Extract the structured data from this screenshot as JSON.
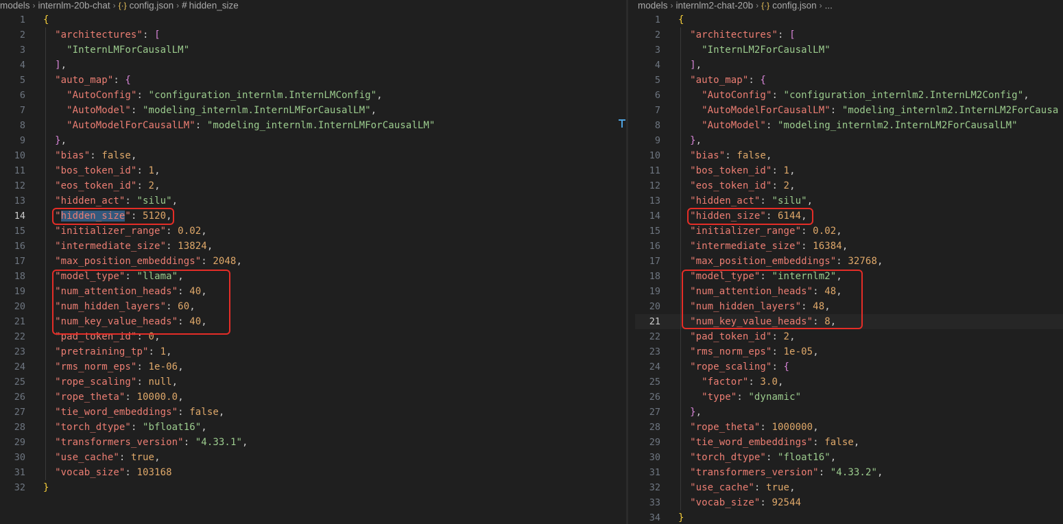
{
  "left": {
    "breadcrumb": [
      "models",
      "internlm-20b-chat",
      "config.json",
      "hidden_size"
    ],
    "active_line": 14,
    "lines": [
      [
        {
          "t": "{",
          "c": "br"
        }
      ],
      [
        {
          "t": "  "
        },
        {
          "t": "\"architectures\"",
          "c": "k"
        },
        {
          "t": ": "
        },
        {
          "t": "[",
          "c": "br2"
        }
      ],
      [
        {
          "t": "    "
        },
        {
          "t": "\"InternLMForCausalLM\"",
          "c": "s"
        }
      ],
      [
        {
          "t": "  "
        },
        {
          "t": "]",
          "c": "br2"
        },
        {
          "t": ","
        }
      ],
      [
        {
          "t": "  "
        },
        {
          "t": "\"auto_map\"",
          "c": "k"
        },
        {
          "t": ": "
        },
        {
          "t": "{",
          "c": "br2"
        }
      ],
      [
        {
          "t": "    "
        },
        {
          "t": "\"AutoConfig\"",
          "c": "k"
        },
        {
          "t": ": "
        },
        {
          "t": "\"configuration_internlm.InternLMConfig\"",
          "c": "s"
        },
        {
          "t": ","
        }
      ],
      [
        {
          "t": "    "
        },
        {
          "t": "\"AutoModel\"",
          "c": "k"
        },
        {
          "t": ": "
        },
        {
          "t": "\"modeling_internlm.InternLMForCausalLM\"",
          "c": "s"
        },
        {
          "t": ","
        }
      ],
      [
        {
          "t": "    "
        },
        {
          "t": "\"AutoModelForCausalLM\"",
          "c": "k"
        },
        {
          "t": ": "
        },
        {
          "t": "\"modeling_internlm.InternLMForCausalLM\"",
          "c": "s"
        }
      ],
      [
        {
          "t": "  "
        },
        {
          "t": "}",
          "c": "br2"
        },
        {
          "t": ","
        }
      ],
      [
        {
          "t": "  "
        },
        {
          "t": "\"bias\"",
          "c": "k"
        },
        {
          "t": ": "
        },
        {
          "t": "false",
          "c": "c"
        },
        {
          "t": ","
        }
      ],
      [
        {
          "t": "  "
        },
        {
          "t": "\"bos_token_id\"",
          "c": "k"
        },
        {
          "t": ": "
        },
        {
          "t": "1",
          "c": "n"
        },
        {
          "t": ","
        }
      ],
      [
        {
          "t": "  "
        },
        {
          "t": "\"eos_token_id\"",
          "c": "k"
        },
        {
          "t": ": "
        },
        {
          "t": "2",
          "c": "n"
        },
        {
          "t": ","
        }
      ],
      [
        {
          "t": "  "
        },
        {
          "t": "\"hidden_act\"",
          "c": "k"
        },
        {
          "t": ": "
        },
        {
          "t": "\"silu\"",
          "c": "s"
        },
        {
          "t": ","
        }
      ],
      [
        {
          "t": "  "
        },
        {
          "t": "\"",
          "c": "k"
        },
        {
          "t": "hidden_size",
          "c": "k sel"
        },
        {
          "t": "\"",
          "c": "k"
        },
        {
          "t": ": "
        },
        {
          "t": "5120",
          "c": "n"
        },
        {
          "t": ","
        }
      ],
      [
        {
          "t": "  "
        },
        {
          "t": "\"initializer_range\"",
          "c": "k"
        },
        {
          "t": ": "
        },
        {
          "t": "0.02",
          "c": "n"
        },
        {
          "t": ","
        }
      ],
      [
        {
          "t": "  "
        },
        {
          "t": "\"intermediate_size\"",
          "c": "k"
        },
        {
          "t": ": "
        },
        {
          "t": "13824",
          "c": "n"
        },
        {
          "t": ","
        }
      ],
      [
        {
          "t": "  "
        },
        {
          "t": "\"max_position_embeddings\"",
          "c": "k"
        },
        {
          "t": ": "
        },
        {
          "t": "2048",
          "c": "n"
        },
        {
          "t": ","
        }
      ],
      [
        {
          "t": "  "
        },
        {
          "t": "\"model_type\"",
          "c": "k"
        },
        {
          "t": ": "
        },
        {
          "t": "\"llama\"",
          "c": "s"
        },
        {
          "t": ","
        }
      ],
      [
        {
          "t": "  "
        },
        {
          "t": "\"num_attention_heads\"",
          "c": "k"
        },
        {
          "t": ": "
        },
        {
          "t": "40",
          "c": "n"
        },
        {
          "t": ","
        }
      ],
      [
        {
          "t": "  "
        },
        {
          "t": "\"num_hidden_layers\"",
          "c": "k"
        },
        {
          "t": ": "
        },
        {
          "t": "60",
          "c": "n"
        },
        {
          "t": ","
        }
      ],
      [
        {
          "t": "  "
        },
        {
          "t": "\"num_key_value_heads\"",
          "c": "k"
        },
        {
          "t": ": "
        },
        {
          "t": "40",
          "c": "n"
        },
        {
          "t": ","
        }
      ],
      [
        {
          "t": "  "
        },
        {
          "t": "\"pad_token_id\"",
          "c": "k"
        },
        {
          "t": ": "
        },
        {
          "t": "0",
          "c": "n"
        },
        {
          "t": ","
        }
      ],
      [
        {
          "t": "  "
        },
        {
          "t": "\"pretraining_tp\"",
          "c": "k"
        },
        {
          "t": ": "
        },
        {
          "t": "1",
          "c": "n"
        },
        {
          "t": ","
        }
      ],
      [
        {
          "t": "  "
        },
        {
          "t": "\"rms_norm_eps\"",
          "c": "k"
        },
        {
          "t": ": "
        },
        {
          "t": "1e-06",
          "c": "n"
        },
        {
          "t": ","
        }
      ],
      [
        {
          "t": "  "
        },
        {
          "t": "\"rope_scaling\"",
          "c": "k"
        },
        {
          "t": ": "
        },
        {
          "t": "null",
          "c": "c"
        },
        {
          "t": ","
        }
      ],
      [
        {
          "t": "  "
        },
        {
          "t": "\"rope_theta\"",
          "c": "k"
        },
        {
          "t": ": "
        },
        {
          "t": "10000.0",
          "c": "n"
        },
        {
          "t": ","
        }
      ],
      [
        {
          "t": "  "
        },
        {
          "t": "\"tie_word_embeddings\"",
          "c": "k"
        },
        {
          "t": ": "
        },
        {
          "t": "false",
          "c": "c"
        },
        {
          "t": ","
        }
      ],
      [
        {
          "t": "  "
        },
        {
          "t": "\"torch_dtype\"",
          "c": "k"
        },
        {
          "t": ": "
        },
        {
          "t": "\"bfloat16\"",
          "c": "s"
        },
        {
          "t": ","
        }
      ],
      [
        {
          "t": "  "
        },
        {
          "t": "\"transformers_version\"",
          "c": "k"
        },
        {
          "t": ": "
        },
        {
          "t": "\"4.33.1\"",
          "c": "s"
        },
        {
          "t": ","
        }
      ],
      [
        {
          "t": "  "
        },
        {
          "t": "\"use_cache\"",
          "c": "k"
        },
        {
          "t": ": "
        },
        {
          "t": "true",
          "c": "c"
        },
        {
          "t": ","
        }
      ],
      [
        {
          "t": "  "
        },
        {
          "t": "\"vocab_size\"",
          "c": "k"
        },
        {
          "t": ": "
        },
        {
          "t": "103168",
          "c": "n"
        }
      ],
      [
        {
          "t": "}",
          "c": "br"
        }
      ]
    ]
  },
  "right": {
    "breadcrumb": [
      "models",
      "internlm2-chat-20b",
      "config.json",
      "..."
    ],
    "active_line": 21,
    "lines": [
      [
        {
          "t": "{",
          "c": "br"
        }
      ],
      [
        {
          "t": "  "
        },
        {
          "t": "\"architectures\"",
          "c": "k"
        },
        {
          "t": ": "
        },
        {
          "t": "[",
          "c": "br2"
        }
      ],
      [
        {
          "t": "    "
        },
        {
          "t": "\"InternLM2ForCausalLM\"",
          "c": "s"
        }
      ],
      [
        {
          "t": "  "
        },
        {
          "t": "]",
          "c": "br2"
        },
        {
          "t": ","
        }
      ],
      [
        {
          "t": "  "
        },
        {
          "t": "\"auto_map\"",
          "c": "k"
        },
        {
          "t": ": "
        },
        {
          "t": "{",
          "c": "br2"
        }
      ],
      [
        {
          "t": "    "
        },
        {
          "t": "\"AutoConfig\"",
          "c": "k"
        },
        {
          "t": ": "
        },
        {
          "t": "\"configuration_internlm2.InternLM2Config\"",
          "c": "s"
        },
        {
          "t": ","
        }
      ],
      [
        {
          "t": "    "
        },
        {
          "t": "\"AutoModelForCausalLM\"",
          "c": "k"
        },
        {
          "t": ": "
        },
        {
          "t": "\"modeling_internlm2.InternLM2ForCausa",
          "c": "s"
        }
      ],
      [
        {
          "t": "    "
        },
        {
          "t": "\"AutoModel\"",
          "c": "k"
        },
        {
          "t": ": "
        },
        {
          "t": "\"modeling_internlm2.InternLM2ForCausalLM\"",
          "c": "s"
        }
      ],
      [
        {
          "t": "  "
        },
        {
          "t": "}",
          "c": "br2"
        },
        {
          "t": ","
        }
      ],
      [
        {
          "t": "  "
        },
        {
          "t": "\"bias\"",
          "c": "k"
        },
        {
          "t": ": "
        },
        {
          "t": "false",
          "c": "c"
        },
        {
          "t": ","
        }
      ],
      [
        {
          "t": "  "
        },
        {
          "t": "\"bos_token_id\"",
          "c": "k"
        },
        {
          "t": ": "
        },
        {
          "t": "1",
          "c": "n"
        },
        {
          "t": ","
        }
      ],
      [
        {
          "t": "  "
        },
        {
          "t": "\"eos_token_id\"",
          "c": "k"
        },
        {
          "t": ": "
        },
        {
          "t": "2",
          "c": "n"
        },
        {
          "t": ","
        }
      ],
      [
        {
          "t": "  "
        },
        {
          "t": "\"hidden_act\"",
          "c": "k"
        },
        {
          "t": ": "
        },
        {
          "t": "\"silu\"",
          "c": "s"
        },
        {
          "t": ","
        }
      ],
      [
        {
          "t": "  "
        },
        {
          "t": "\"hidden_size\"",
          "c": "k"
        },
        {
          "t": ": "
        },
        {
          "t": "6144",
          "c": "n"
        },
        {
          "t": ","
        }
      ],
      [
        {
          "t": "  "
        },
        {
          "t": "\"initializer_range\"",
          "c": "k"
        },
        {
          "t": ": "
        },
        {
          "t": "0.02",
          "c": "n"
        },
        {
          "t": ","
        }
      ],
      [
        {
          "t": "  "
        },
        {
          "t": "\"intermediate_size\"",
          "c": "k"
        },
        {
          "t": ": "
        },
        {
          "t": "16384",
          "c": "n"
        },
        {
          "t": ","
        }
      ],
      [
        {
          "t": "  "
        },
        {
          "t": "\"max_position_embeddings\"",
          "c": "k"
        },
        {
          "t": ": "
        },
        {
          "t": "32768",
          "c": "n"
        },
        {
          "t": ","
        }
      ],
      [
        {
          "t": "  "
        },
        {
          "t": "\"model_type\"",
          "c": "k"
        },
        {
          "t": ": "
        },
        {
          "t": "\"internlm2\"",
          "c": "s"
        },
        {
          "t": ","
        }
      ],
      [
        {
          "t": "  "
        },
        {
          "t": "\"num_attention_heads\"",
          "c": "k"
        },
        {
          "t": ": "
        },
        {
          "t": "48",
          "c": "n"
        },
        {
          "t": ","
        }
      ],
      [
        {
          "t": "  "
        },
        {
          "t": "\"num_hidden_layers\"",
          "c": "k"
        },
        {
          "t": ": "
        },
        {
          "t": "48",
          "c": "n"
        },
        {
          "t": ","
        }
      ],
      [
        {
          "t": "  "
        },
        {
          "t": "\"num_key_value_heads\"",
          "c": "k"
        },
        {
          "t": ": "
        },
        {
          "t": "8",
          "c": "n"
        },
        {
          "t": ","
        }
      ],
      [
        {
          "t": "  "
        },
        {
          "t": "\"pad_token_id\"",
          "c": "k"
        },
        {
          "t": ": "
        },
        {
          "t": "2",
          "c": "n"
        },
        {
          "t": ","
        }
      ],
      [
        {
          "t": "  "
        },
        {
          "t": "\"rms_norm_eps\"",
          "c": "k"
        },
        {
          "t": ": "
        },
        {
          "t": "1e-05",
          "c": "n"
        },
        {
          "t": ","
        }
      ],
      [
        {
          "t": "  "
        },
        {
          "t": "\"rope_scaling\"",
          "c": "k"
        },
        {
          "t": ": "
        },
        {
          "t": "{",
          "c": "br2"
        }
      ],
      [
        {
          "t": "    "
        },
        {
          "t": "\"factor\"",
          "c": "k"
        },
        {
          "t": ": "
        },
        {
          "t": "3.0",
          "c": "n"
        },
        {
          "t": ","
        }
      ],
      [
        {
          "t": "    "
        },
        {
          "t": "\"type\"",
          "c": "k"
        },
        {
          "t": ": "
        },
        {
          "t": "\"dynamic\"",
          "c": "s"
        }
      ],
      [
        {
          "t": "  "
        },
        {
          "t": "}",
          "c": "br2"
        },
        {
          "t": ","
        }
      ],
      [
        {
          "t": "  "
        },
        {
          "t": "\"rope_theta\"",
          "c": "k"
        },
        {
          "t": ": "
        },
        {
          "t": "1000000",
          "c": "n"
        },
        {
          "t": ","
        }
      ],
      [
        {
          "t": "  "
        },
        {
          "t": "\"tie_word_embeddings\"",
          "c": "k"
        },
        {
          "t": ": "
        },
        {
          "t": "false",
          "c": "c"
        },
        {
          "t": ","
        }
      ],
      [
        {
          "t": "  "
        },
        {
          "t": "\"torch_dtype\"",
          "c": "k"
        },
        {
          "t": ": "
        },
        {
          "t": "\"float16\"",
          "c": "s"
        },
        {
          "t": ","
        }
      ],
      [
        {
          "t": "  "
        },
        {
          "t": "\"transformers_version\"",
          "c": "k"
        },
        {
          "t": ": "
        },
        {
          "t": "\"4.33.2\"",
          "c": "s"
        },
        {
          "t": ","
        }
      ],
      [
        {
          "t": "  "
        },
        {
          "t": "\"use_cache\"",
          "c": "k"
        },
        {
          "t": ": "
        },
        {
          "t": "true",
          "c": "c"
        },
        {
          "t": ","
        }
      ],
      [
        {
          "t": "  "
        },
        {
          "t": "\"vocab_size\"",
          "c": "k"
        },
        {
          "t": ": "
        },
        {
          "t": "92544",
          "c": "n"
        }
      ],
      [
        {
          "t": "}",
          "c": "br"
        }
      ]
    ]
  },
  "annotation_color": "#e52d27"
}
